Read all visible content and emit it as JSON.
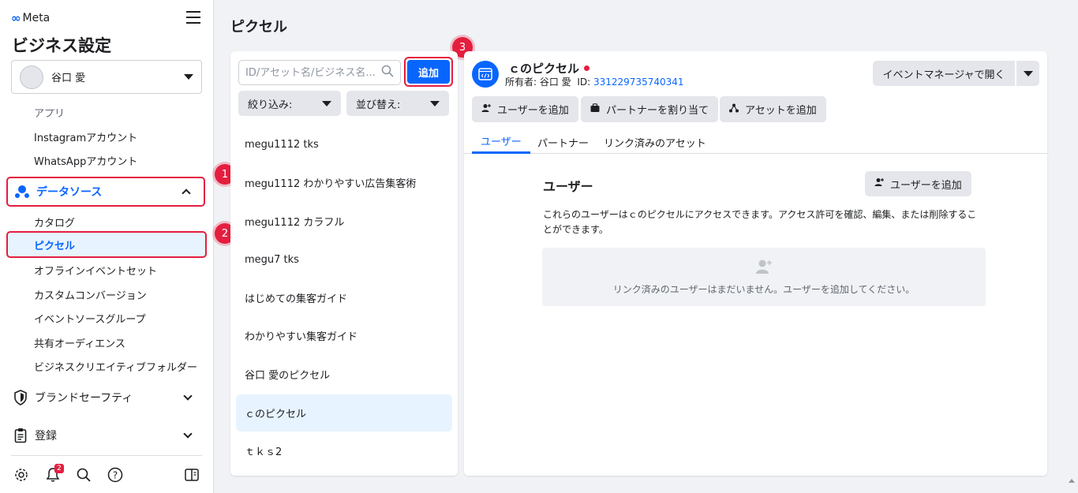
{
  "brand": {
    "logo_text": "Meta"
  },
  "sidebar": {
    "title": "ビジネス設定",
    "account_name": "谷口 愛",
    "sub_items_top": [
      {
        "label": "アプリ"
      },
      {
        "label": "Instagramアカウント"
      },
      {
        "label": "WhatsAppアカウント"
      }
    ],
    "data_sources_label": "データソース",
    "data_sources_items": [
      {
        "label": "カタログ"
      },
      {
        "label": "ピクセル"
      },
      {
        "label": "オフラインイベントセット"
      },
      {
        "label": "カスタムコンバージョン"
      },
      {
        "label": "イベントソースグループ"
      },
      {
        "label": "共有オーディエンス"
      },
      {
        "label": "ビジネスクリエイティブフォルダー"
      }
    ],
    "brand_safety_label": "ブランドセーフティ",
    "registration_label": "登録",
    "notification_count": "2"
  },
  "steps": {
    "one": "1",
    "two": "2",
    "three": "3"
  },
  "main": {
    "page_title": "ピクセル",
    "search_placeholder": "ID/アセット名/ビジネス名...",
    "add_label": "追加",
    "filter_label": "絞り込み:",
    "sort_label": "並び替え:",
    "pixels": [
      {
        "name": "megu1112 tks"
      },
      {
        "name": "megu1112 わかりやすい広告集客術"
      },
      {
        "name": "megu1112 カラフル"
      },
      {
        "name": "megu7 tks"
      },
      {
        "name": "はじめての集客ガイド"
      },
      {
        "name": "わかりやすい集客ガイド"
      },
      {
        "name": "谷口 愛のピクセル"
      },
      {
        "name": "ｃのピクセル"
      },
      {
        "name": "ｔｋｓ2"
      }
    ],
    "selected_index": 7
  },
  "detail": {
    "pixel_name": "ｃのピクセル",
    "owner_prefix": "所有者: 谷口 愛",
    "id_prefix": "ID:",
    "id_value": "331229735740341",
    "open_event_manager": "イベントマネージャで開く",
    "actions": {
      "add_user": "ユーザーを追加",
      "assign_partner": "パートナーを割り当て",
      "add_asset": "アセットを追加"
    },
    "tabs": [
      {
        "label": "ユーザー"
      },
      {
        "label": "パートナー"
      },
      {
        "label": "リンク済みのアセット"
      }
    ],
    "section_title": "ユーザー",
    "section_add_user": "ユーザーを追加",
    "section_desc": "これらのユーザーはｃのピクセルにアクセスできます。アクセス許可を確認、編集、または削除することができます。",
    "empty_text": "リンク済みのユーザーはまだいません。ユーザーを追加してください。"
  },
  "colors": {
    "accent": "#0866ff",
    "highlight": "#e41e3f",
    "selected_bg": "#e7f3ff"
  }
}
